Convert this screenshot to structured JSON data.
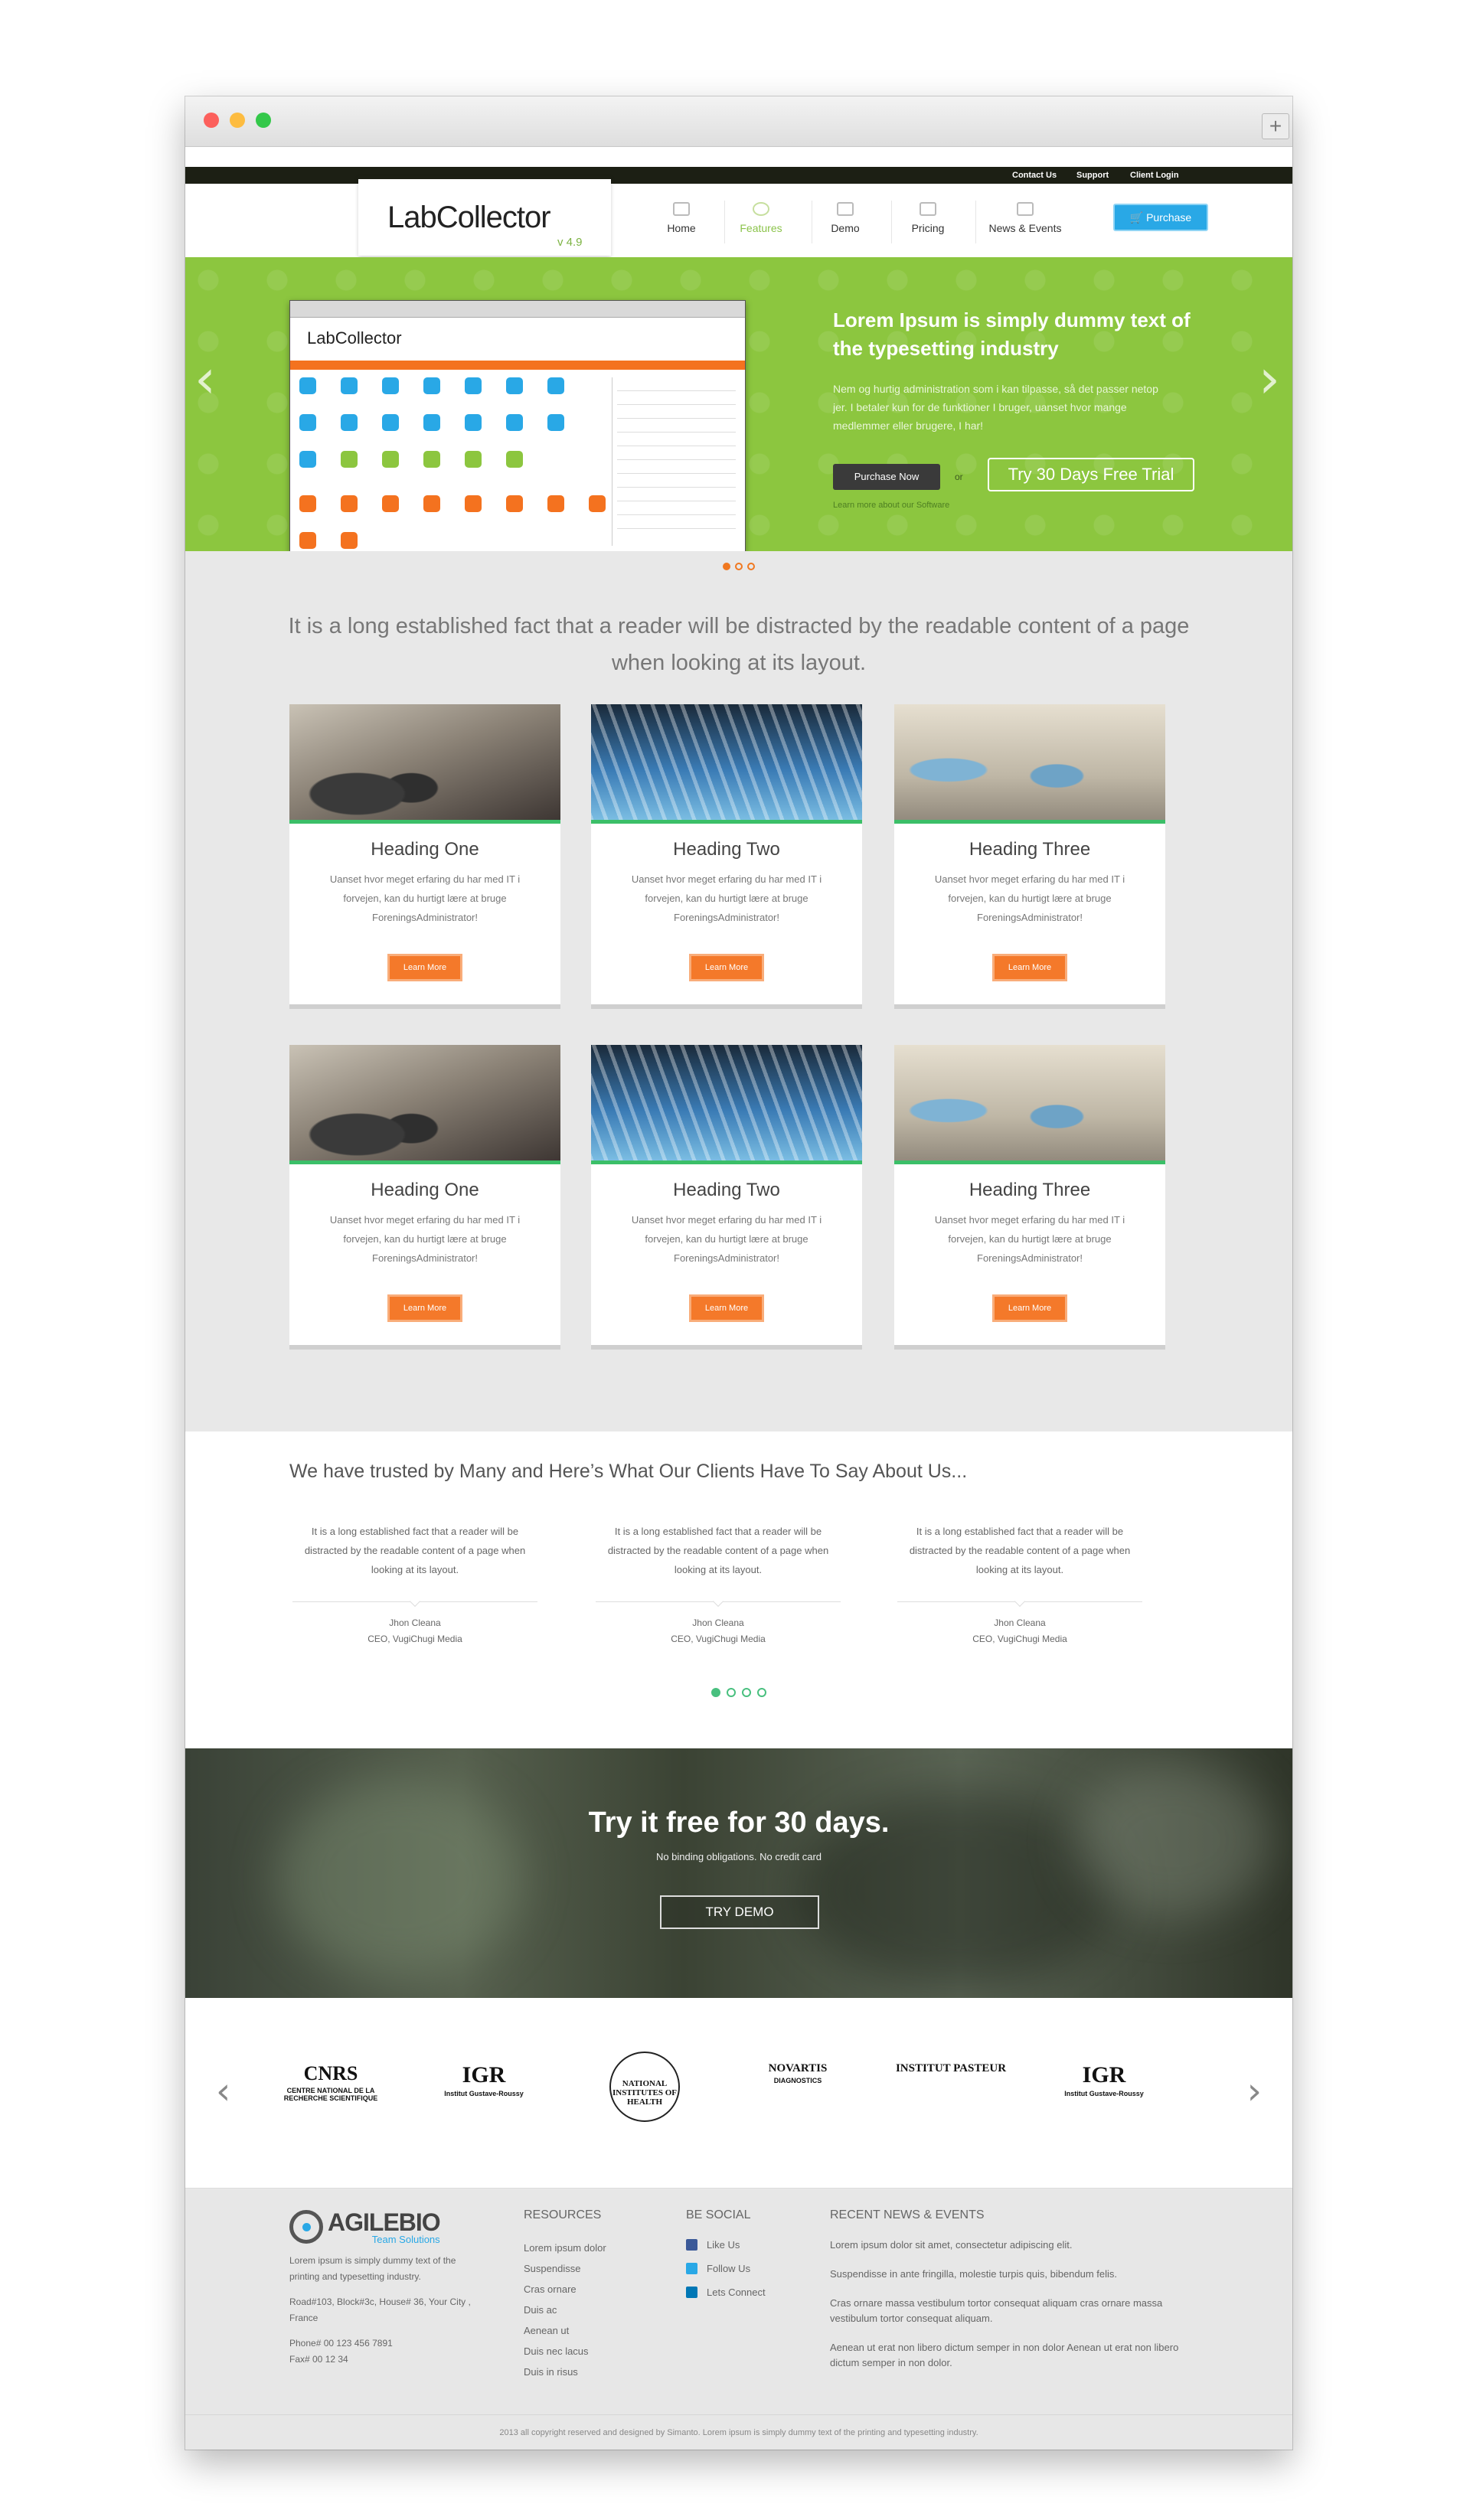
{
  "topbar": {
    "links": [
      "Contact Us",
      "Support",
      "Client Login"
    ]
  },
  "header": {
    "logo": "LabCollector",
    "version": "v 4.9",
    "nav": [
      "Home",
      "Features",
      "Demo",
      "Pricing",
      "News & Events"
    ],
    "active_nav": "Features",
    "purchase_label": "Purchase"
  },
  "hero": {
    "title": "Lorem Ipsum is simply dummy text of the typesetting industry",
    "text": "Nem og hurtig administration som i kan tilpasse, så det passer netop jer. I betaler kun for de funktioner I bruger, uanset hvor mange medlemmer eller brugere, I har!",
    "purchase_label": "Purchase Now",
    "or": "or",
    "trial_label": "Try 30 Days Free Trial",
    "learn_more": "Learn more about our Software",
    "screenshot_logo": "LabCollector",
    "slide_count": 3,
    "active_slide": 1
  },
  "intro": "It is a long established fact that a reader will be distracted by the readable content of a page when looking at its layout.",
  "cards": [
    {
      "heading": "Heading One",
      "text": "Uanset hvor meget erfaring du har med IT i forvejen, kan du hurtigt lære at bruge ForeningsAdministrator!",
      "button": "Learn More"
    },
    {
      "heading": "Heading Two",
      "text": "Uanset hvor meget erfaring du har med IT i forvejen, kan du hurtigt lære at bruge ForeningsAdministrator!",
      "button": "Learn More"
    },
    {
      "heading": "Heading Three",
      "text": "Uanset hvor meget erfaring du har med IT i forvejen, kan du hurtigt lære at bruge ForeningsAdministrator!",
      "button": "Learn More"
    },
    {
      "heading": "Heading One",
      "text": "Uanset hvor meget erfaring du har med IT i forvejen, kan du hurtigt lære at bruge ForeningsAdministrator!",
      "button": "Learn More"
    },
    {
      "heading": "Heading Two",
      "text": "Uanset hvor meget erfaring du har med IT i forvejen, kan du hurtigt lære at bruge ForeningsAdministrator!",
      "button": "Learn More"
    },
    {
      "heading": "Heading Three",
      "text": "Uanset hvor meget erfaring du har med IT i forvejen, kan du hurtigt lære at bruge ForeningsAdministrator!",
      "button": "Learn More"
    }
  ],
  "testimonials": {
    "title": "We have trusted by Many and Here’s What Our Clients Have To Say About Us...",
    "items": [
      {
        "quote": "It is a long established fact that a reader will be distracted by the readable content of a page when looking at its layout.",
        "name": "Jhon Cleana",
        "role": "CEO,  VugiChugi Media"
      },
      {
        "quote": "It is a long established fact that a reader will be distracted by the readable content of a page when looking at its layout.",
        "name": "Jhon Cleana",
        "role": "CEO,  VugiChugi Media"
      },
      {
        "quote": "It is a long established fact that a reader will be distracted by the readable content of a page when looking at its layout.",
        "name": "Jhon Cleana",
        "role": "CEO,  VugiChugi Media"
      }
    ],
    "page_count": 4,
    "active_page": 1
  },
  "cta": {
    "title": "Try it free for 30 days.",
    "subtitle": "No binding obligations. No credit card",
    "button": "TRY DEMO"
  },
  "partners": [
    {
      "name": "CNRS",
      "sub": "CENTRE NATIONAL DE LA RECHERCHE SCIENTIFIQUE"
    },
    {
      "name": "IGR",
      "sub": "Institut Gustave-Roussy"
    },
    {
      "name": "NATIONAL INSTITUTES OF HEALTH",
      "sub": ""
    },
    {
      "name": "NOVARTIS",
      "sub": "DIAGNOSTICS"
    },
    {
      "name": "INSTITUT PASTEUR",
      "sub": ""
    },
    {
      "name": "IGR",
      "sub": "Institut Gustave-Roussy"
    }
  ],
  "footer": {
    "brand": "AGILEBIO",
    "brand_sub": "Team Solutions",
    "about": "Lorem ipsum is simply dummy text of the printing and typesetting industry.",
    "address": "Road#103, Block#3c, House# 36, Your City , France",
    "phone": "Phone# 00 123 456 7891",
    "fax": "Fax# 00 12 34",
    "resources_title": "RESOURCES",
    "resources": [
      "Lorem ipsum dolor",
      "Suspendisse",
      "Cras ornare",
      "Duis ac",
      "Aenean ut",
      "Duis nec lacus",
      "Duis in risus"
    ],
    "social_title": "BE SOCIAL",
    "social": [
      "Like Us",
      "Follow Us",
      "Lets Connect"
    ],
    "news_title": "RECENT NEWS & EVENTS",
    "news": [
      "Lorem ipsum dolor sit amet, consectetur adipiscing elit.",
      "Suspendisse in ante fringilla, molestie turpis quis, bibendum felis.",
      "Cras ornare massa vestibulum tortor consequat aliquam cras ornare massa vestibulum tortor consequat aliquam.",
      "Aenean ut erat non libero dictum semper in non dolor Aenean ut erat non libero dictum semper in non dolor."
    ],
    "copyright": "2013 all copyright reserved and designed by Simanto. Lorem ipsum is simply dummy text of the printing and typesetting industry."
  },
  "colors": {
    "accent_green": "#8cc63f",
    "orange": "#f4792a",
    "blue": "#29a8e6",
    "teal": "#49c07f"
  }
}
